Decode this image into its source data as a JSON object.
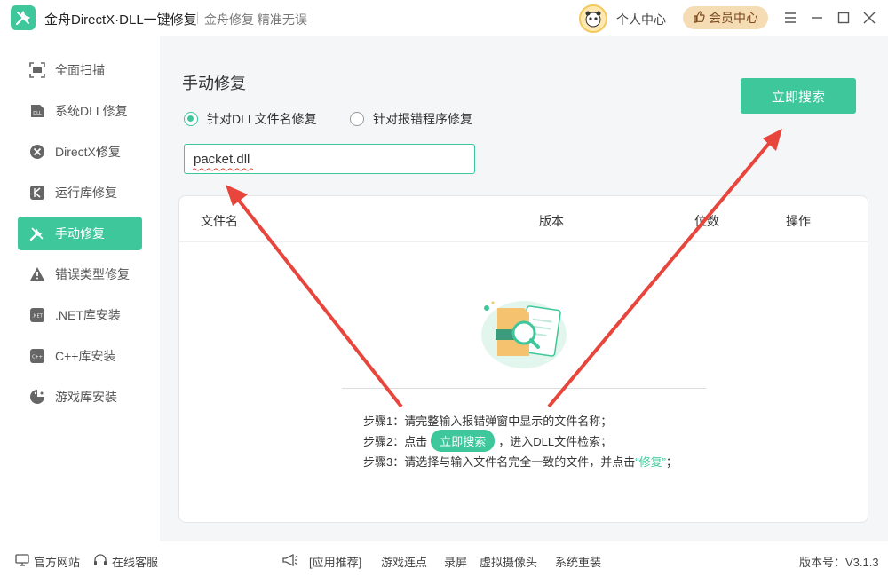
{
  "app": {
    "title": "金舟DirectX·DLL一键修复",
    "subtitle": "金舟修复 精准无误",
    "profile_label": "个人中心",
    "vip_label": "会员中心"
  },
  "colors": {
    "accent": "#3ec79a",
    "vip_bg": "#f6dcb5",
    "arrow": "#e8453c"
  },
  "sidebar": {
    "items": [
      {
        "label": "全面扫描",
        "icon": "scan-icon"
      },
      {
        "label": "系统DLL修复",
        "icon": "dll-icon"
      },
      {
        "label": "DirectX修复",
        "icon": "directx-icon"
      },
      {
        "label": "运行库修复",
        "icon": "runtime-icon"
      },
      {
        "label": "手动修复",
        "icon": "wrench-icon",
        "active": true
      },
      {
        "label": "错误类型修复",
        "icon": "warning-icon"
      },
      {
        "label": ".NET库安装",
        "icon": "dotnet-icon"
      },
      {
        "label": "C++库安装",
        "icon": "cpp-icon"
      },
      {
        "label": "游戏库安装",
        "icon": "game-icon"
      }
    ]
  },
  "main": {
    "title": "手动修复",
    "radio_dll": "针对DLL文件名修复",
    "radio_program": "针对报错程序修复",
    "search_value": "packet.dll",
    "search_button": "立即搜索",
    "table": {
      "col_name": "文件名",
      "col_version": "版本",
      "col_bits": "位数",
      "col_action": "操作"
    },
    "steps": {
      "step1": "步骤1：请完整输入报错弹窗中显示的文件名称；",
      "step2_pre": "步骤2：点击",
      "step2_btn": "立即搜索",
      "step2_post": "，进入DLL文件检索；",
      "step3_pre": "步骤3：请选择与输入文件名完全一致的文件，并点击",
      "step3_hl": "“修复”",
      "step3_post": "；"
    }
  },
  "footer": {
    "website": "官方网站",
    "service": "在线客服",
    "recommend": "[应用推荐]",
    "link1": "游戏连点",
    "link2": "录屏",
    "link3": "虚拟摄像头",
    "link4": "系统重装",
    "version": "版本号：V3.1.3"
  }
}
